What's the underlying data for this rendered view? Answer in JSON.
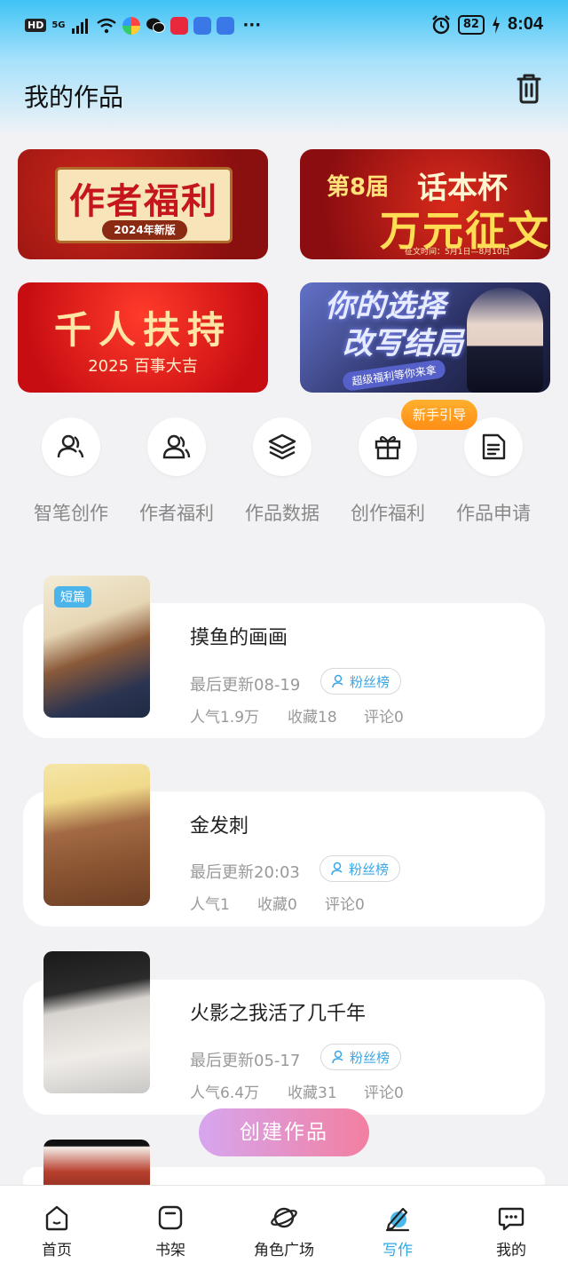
{
  "status_bar": {
    "hd": "HD",
    "network": "5G",
    "more": "···",
    "battery": "82",
    "time": "8:04"
  },
  "header": {
    "title": "我的作品",
    "delete_icon": "trash-icon"
  },
  "banners": [
    {
      "title": "作者福利",
      "subtitle": "2024年新版"
    },
    {
      "prefix": "第8届",
      "cup": "话本杯",
      "main": "万元征文",
      "date": "征文时间：5月1日—8月10日"
    },
    {
      "title": "千人扶持",
      "subtitle": "2025 百事大吉"
    },
    {
      "title_line1": "你的选择",
      "title_line2": "改写结局",
      "subtitle": "超级福利等你来拿"
    }
  ],
  "quick_entries": [
    {
      "label": "智笔创作",
      "icon": "user-pen-icon"
    },
    {
      "label": "作者福利",
      "icon": "users-icon"
    },
    {
      "label": "作品数据",
      "icon": "layers-icon"
    },
    {
      "label": "创作福利",
      "icon": "gift-icon"
    },
    {
      "label": "作品申请",
      "icon": "document-icon"
    }
  ],
  "guide_tag": "新手引导",
  "works": [
    {
      "tag": "短篇",
      "title": "摸鱼的画画",
      "update": "最后更新08-19",
      "fans": "粉丝榜",
      "popularity": "人气1.9万",
      "favorites": "收藏18",
      "comments": "评论0"
    },
    {
      "title": "金发刺",
      "update": "最后更新20:03",
      "fans": "粉丝榜",
      "popularity": "人气1",
      "favorites": "收藏0",
      "comments": "评论0"
    },
    {
      "title": "火影之我活了几千年",
      "update": "最后更新05-17",
      "fans": "粉丝榜",
      "popularity": "人气6.4万",
      "favorites": "收藏31",
      "comments": "评论0"
    }
  ],
  "create_button": "创建作品",
  "bottom_nav": [
    {
      "label": "首页",
      "icon": "home-icon"
    },
    {
      "label": "书架",
      "icon": "bookshelf-icon"
    },
    {
      "label": "角色广场",
      "icon": "planet-icon"
    },
    {
      "label": "写作",
      "icon": "pen-icon",
      "active": true
    },
    {
      "label": "我的",
      "icon": "chat-bubble-icon"
    }
  ],
  "colors": {
    "accent": "#2fa8e3",
    "guide": "#ff9a1f",
    "tag": "#4bb4ea"
  }
}
